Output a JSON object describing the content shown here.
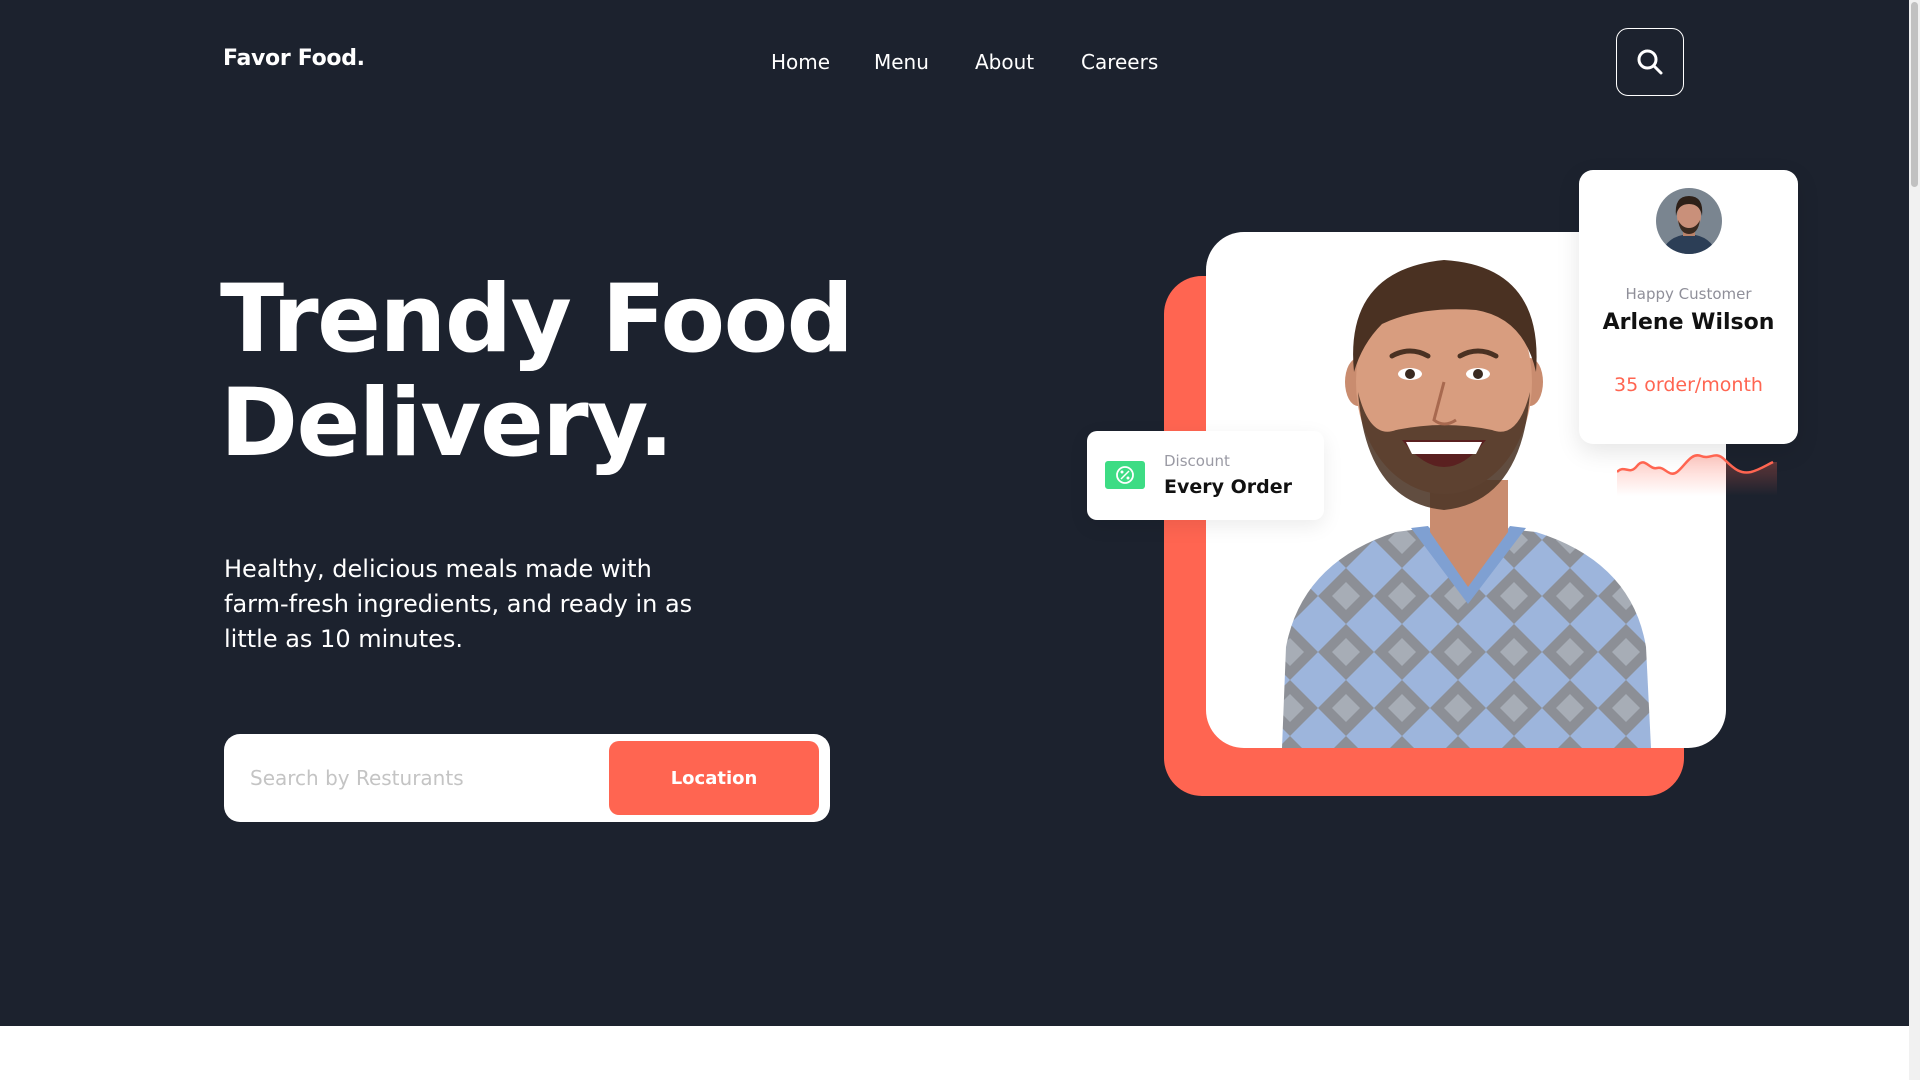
{
  "brand": {
    "name": "Favor Food."
  },
  "nav": {
    "items": [
      {
        "label": "Home"
      },
      {
        "label": "Menu"
      },
      {
        "label": "About"
      },
      {
        "label": "Careers"
      }
    ],
    "search_icon": "search-icon"
  },
  "hero": {
    "headline_line1": "Trendy Food",
    "headline_line2": "Delivery.",
    "description": "Healthy, delicious meals made with farm-fresh ingredients, and ready in as little as 10 minutes."
  },
  "search": {
    "placeholder": "Search by Resturants",
    "value": "",
    "button_label": "Location"
  },
  "discount_card": {
    "icon": "cash-discount-icon",
    "label": "Discount",
    "value": "Every Order"
  },
  "customer_card": {
    "caption": "Happy Customer",
    "name": "Arlene Wilson",
    "orders": "35 order/month"
  },
  "colors": {
    "background": "#1c222e",
    "accent": "#ff6551",
    "discount_icon": "#3ddc84",
    "card": "#ffffff"
  }
}
